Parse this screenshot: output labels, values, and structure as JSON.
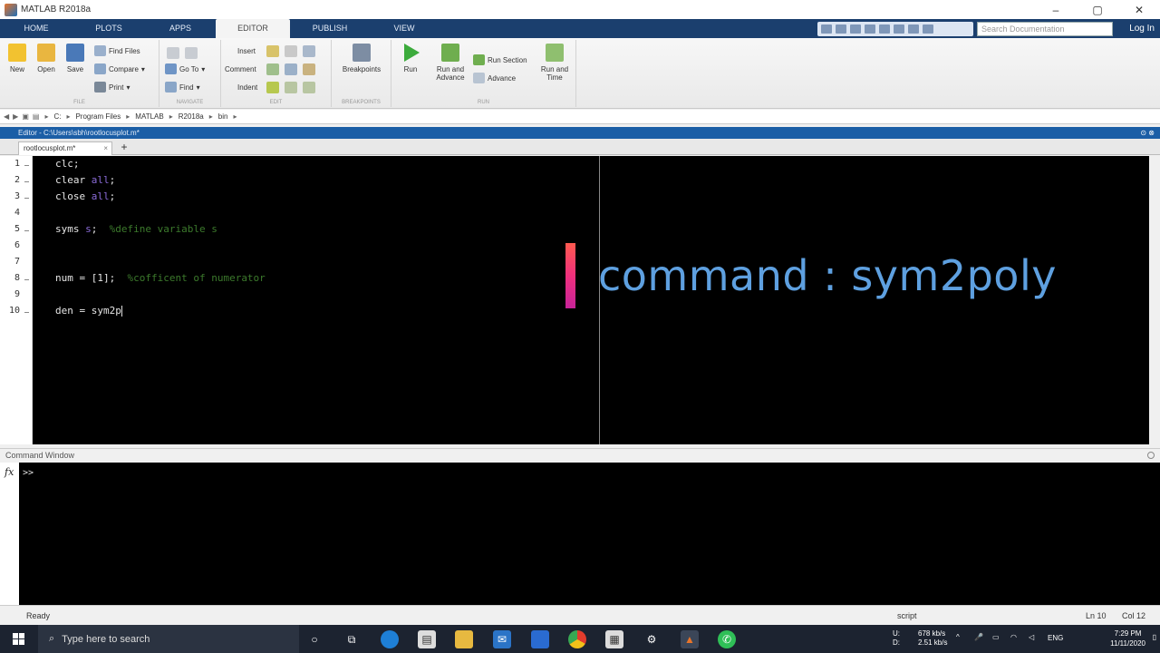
{
  "window": {
    "title": "MATLAB R2018a",
    "controls": [
      "–",
      "▢",
      "✕"
    ]
  },
  "ribbon_tabs": [
    "HOME",
    "PLOTS",
    "APPS",
    "EDITOR",
    "PUBLISH",
    "VIEW"
  ],
  "active_tab": "EDITOR",
  "search": {
    "placeholder": "Search Documentation"
  },
  "login_label": "Log In",
  "ribbon": {
    "file": {
      "new": "New",
      "open": "Open",
      "save": "Save",
      "find_files": "Find Files",
      "compare": "Compare",
      "print": "Print",
      "group": "FILE"
    },
    "navigate": {
      "goto": "Go To",
      "find": "Find",
      "group": "NAVIGATE"
    },
    "edit": {
      "insert": "Insert",
      "comment": "Comment",
      "indent": "Indent",
      "group": "EDIT"
    },
    "breakpoints": {
      "label": "Breakpoints",
      "group": "BREAKPOINTS"
    },
    "run": {
      "run": "Run",
      "run_advance": "Run and Advance",
      "run_section": "Run Section",
      "advance": "Advance",
      "run_time": "Run and Time",
      "group": "RUN"
    }
  },
  "address": [
    "C:",
    "Program Files",
    "MATLAB",
    "R2018a",
    "bin"
  ],
  "editor": {
    "header": "Editor - C:\\Users\\sbh\\rootlocusplot.m*",
    "file_tab": "rootlocusplot.m*",
    "lines": [
      {
        "n": "1",
        "parts": [
          {
            "t": "clc;",
            "c": ""
          }
        ]
      },
      {
        "n": "2",
        "parts": [
          {
            "t": "clear ",
            "c": ""
          },
          {
            "t": "all",
            "c": "kw"
          },
          {
            "t": ";",
            "c": ""
          }
        ]
      },
      {
        "n": "3",
        "parts": [
          {
            "t": "close ",
            "c": ""
          },
          {
            "t": "all",
            "c": "kw"
          },
          {
            "t": ";",
            "c": ""
          }
        ]
      },
      {
        "n": "4",
        "parts": []
      },
      {
        "n": "5",
        "parts": [
          {
            "t": "syms ",
            "c": ""
          },
          {
            "t": "s",
            "c": "kw"
          },
          {
            "t": ";  ",
            "c": ""
          },
          {
            "t": "%define variable s",
            "c": "cm"
          }
        ]
      },
      {
        "n": "6",
        "parts": []
      },
      {
        "n": "7",
        "parts": []
      },
      {
        "n": "8",
        "parts": [
          {
            "t": "num = [1];  ",
            "c": ""
          },
          {
            "t": "%cofficent of numerator",
            "c": "cm"
          }
        ]
      },
      {
        "n": "9",
        "parts": []
      },
      {
        "n": "10",
        "parts": [
          {
            "t": "den = sym2p",
            "c": ""
          }
        ]
      }
    ],
    "overlay_text": "command : sym2poly"
  },
  "command_window": {
    "title": "Command Window",
    "fx": "fx",
    "prompt": ">>"
  },
  "status": {
    "ready": "Ready",
    "mode": "script",
    "ln": "Ln  10",
    "col": "Col  12"
  },
  "taskbar": {
    "search_placeholder": "Type here to search",
    "upload": "U:",
    "download": "D:",
    "net_up": "678 kb/s",
    "net_down": "2.51 kb/s",
    "lang": "ENG",
    "time": "7:29 PM",
    "date": "11/11/2020"
  },
  "colors": {
    "accent": "#1b5ea6",
    "tab_bar": "#1b3f6e",
    "overlay_text": "#5ea0e0",
    "overlay_bar": "#f0307d"
  }
}
